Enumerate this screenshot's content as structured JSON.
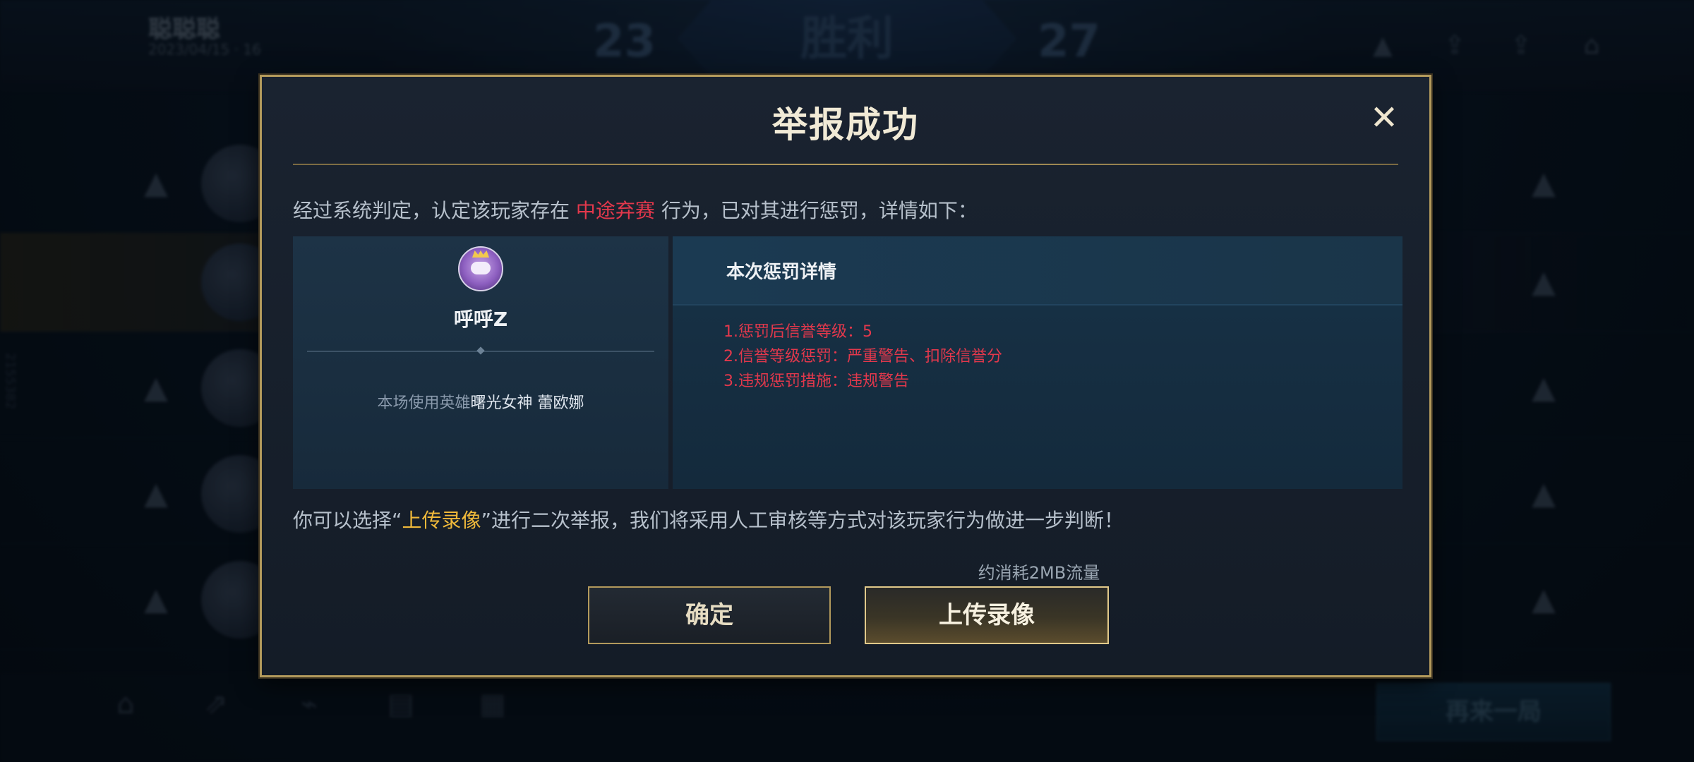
{
  "background": {
    "player_name": "聪聪聪",
    "player_sub": "2023/04/15  ·  16",
    "score_left": "23",
    "score_right": "27",
    "result_text": "胜利",
    "side_id": "2155382",
    "again_button": "再来一局"
  },
  "dialog": {
    "title": "举报成功",
    "close_icon": "✕",
    "verdict_prefix": "经过系统判定，认定该玩家存在",
    "verdict_behavior": "中途弃赛",
    "verdict_suffix": "行为，已对其进行惩罚，详情如下：",
    "player": {
      "name": "呼呼Z",
      "hero_label": "本场使用英雄",
      "hero_name": "曙光女神 蕾欧娜"
    },
    "penalty": {
      "title": "本次惩罚详情",
      "items": [
        "1.惩罚后信誉等级：5",
        "2.信誉等级惩罚：严重警告、扣除信誉分",
        "3.违规惩罚措施：违规警告"
      ]
    },
    "second_report_prefix": "你可以选择“",
    "second_report_link": "上传录像",
    "second_report_suffix": "”进行二次举报，我们将采用人工审核等方式对该玩家行为做进一步判断！",
    "data_note": "约消耗2MB流量",
    "confirm_label": "确定",
    "upload_label": "上传录像"
  },
  "colors": {
    "accent_gold": "#b39a5c",
    "penalty_red": "#e3384c",
    "link_gold": "#f0b93a"
  }
}
